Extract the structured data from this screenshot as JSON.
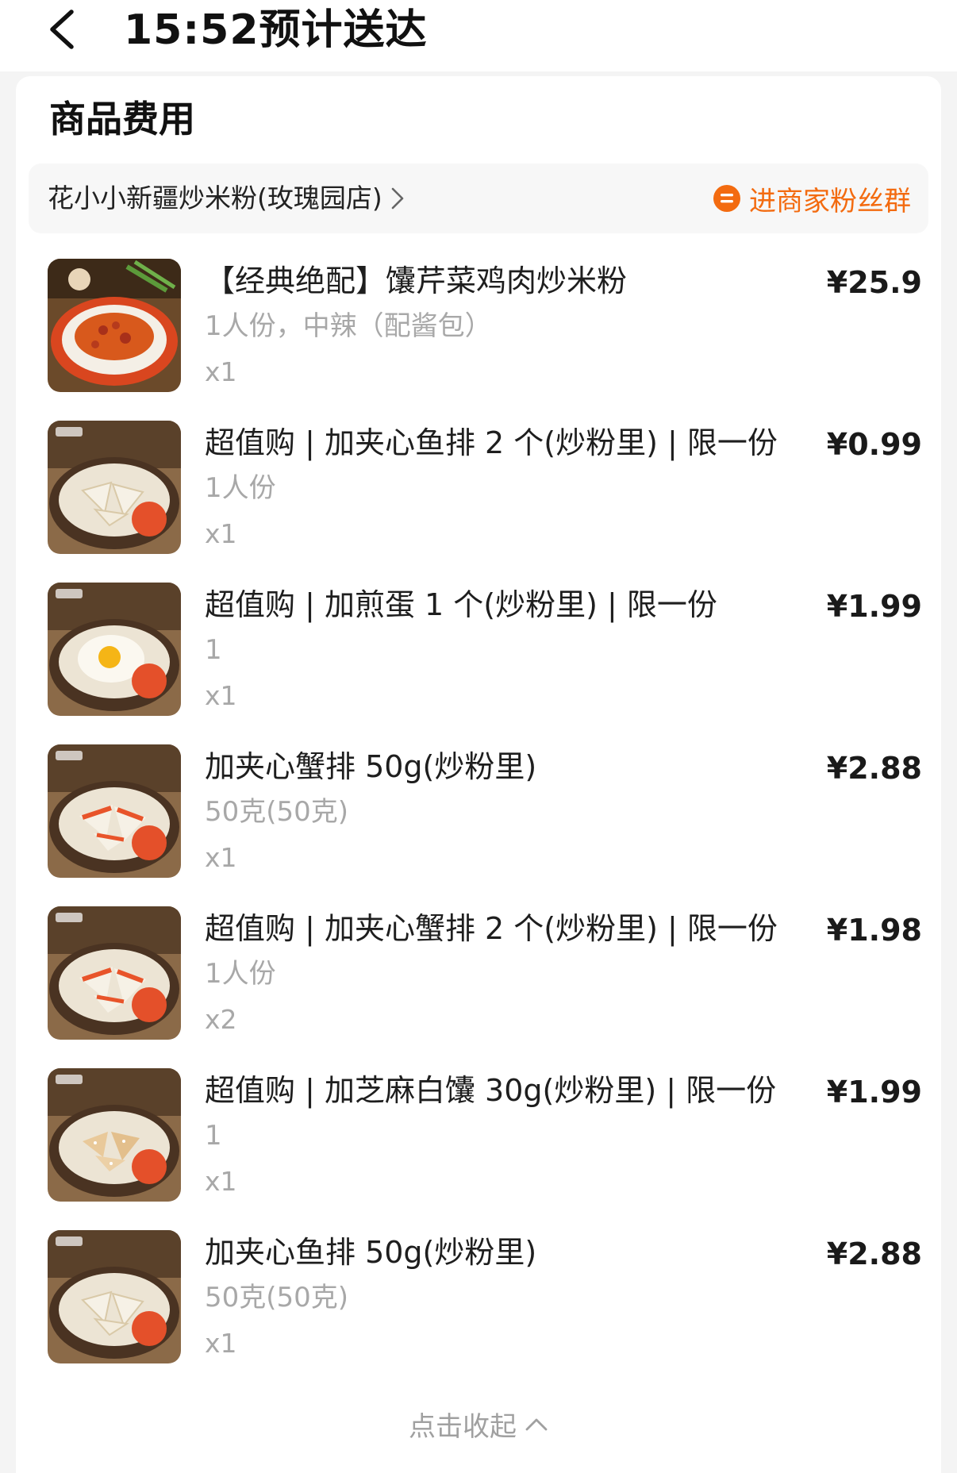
{
  "header": {
    "eta_title": "15:52预计送达"
  },
  "section": {
    "title": "商品费用"
  },
  "store": {
    "name": "花小小新疆炒米粉(玫瑰园店)",
    "fans_group_label": "进商家粉丝群"
  },
  "colors": {
    "accent": "#f36b10"
  },
  "items": [
    {
      "name": "【经典绝配】馕芹菜鸡肉炒米粉",
      "spec": "1人份，中辣（配酱包）",
      "qty": "x1",
      "price": "¥25.9",
      "image": "stir-fried-rice-noodles"
    },
    {
      "name": "超值购 | 加夹心鱼排 2 个(炒粉里) | 限一份",
      "spec": "1人份",
      "qty": "x1",
      "price": "¥0.99",
      "image": "fish-fillet"
    },
    {
      "name": "超值购 | 加煎蛋 1 个(炒粉里) | 限一份",
      "spec": "1",
      "qty": "x1",
      "price": "¥1.99",
      "image": "fried-egg"
    },
    {
      "name": "加夹心蟹排 50g(炒粉里)",
      "spec": "50克(50克)",
      "qty": "x1",
      "price": "¥2.88",
      "image": "crab-stick"
    },
    {
      "name": "超值购 | 加夹心蟹排 2 个(炒粉里) | 限一份",
      "spec": "1人份",
      "qty": "x2",
      "price": "¥1.98",
      "image": "crab-stick"
    },
    {
      "name": "超值购 | 加芝麻白馕 30g(炒粉里) | 限一份",
      "spec": "1",
      "qty": "x1",
      "price": "¥1.99",
      "image": "sesame-naan"
    },
    {
      "name": "加夹心鱼排 50g(炒粉里)",
      "spec": "50克(50克)",
      "qty": "x1",
      "price": "¥2.88",
      "image": "fish-fillet"
    }
  ],
  "collapse_label": "点击收起"
}
